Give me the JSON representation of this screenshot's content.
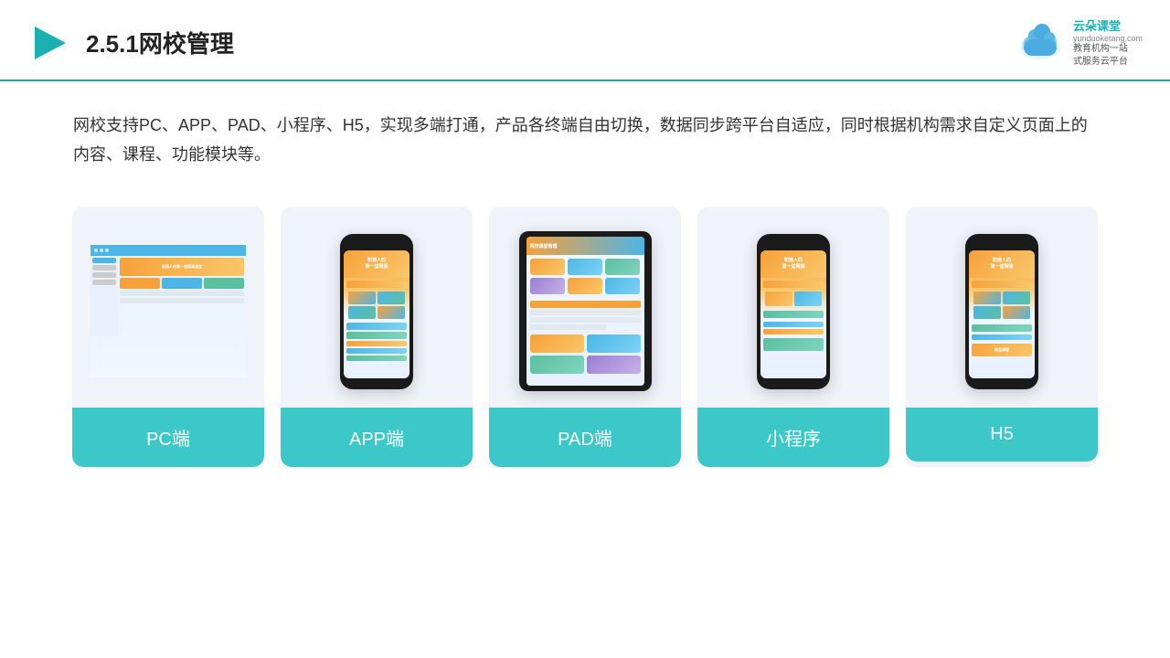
{
  "header": {
    "title": "2.5.1网校管理",
    "logo_name": "云朵课堂",
    "logo_url": "yunduoketang.com",
    "logo_tagline": "教育机构一站\n式服务云平台"
  },
  "description": {
    "text": "网校支持PC、APP、PAD、小程序、H5，实现多端打通，产品各终端自由切换，数据同步跨平台自适应，同时根据机构需求自定义页面上的内容、课程、功能模块等。"
  },
  "cards": [
    {
      "id": "pc",
      "label": "PC端"
    },
    {
      "id": "app",
      "label": "APP端"
    },
    {
      "id": "pad",
      "label": "PAD端"
    },
    {
      "id": "miniprogram",
      "label": "小程序"
    },
    {
      "id": "h5",
      "label": "H5"
    }
  ],
  "colors": {
    "teal": "#3cc8c8",
    "accent_line": "#1ab0b0",
    "bg_card": "#f0f4fa",
    "text_main": "#333",
    "title": "#222"
  }
}
